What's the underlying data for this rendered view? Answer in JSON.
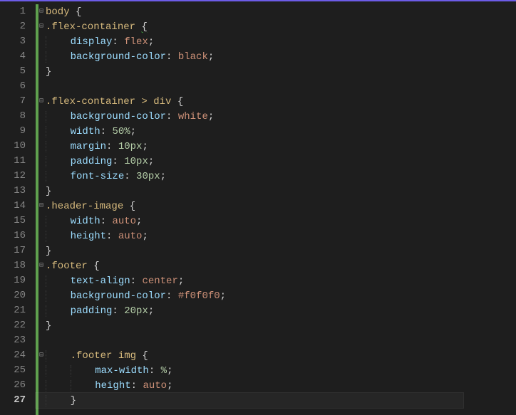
{
  "editor": {
    "activeLine": 27,
    "lines": [
      {
        "num": 1,
        "fold": "⊟",
        "indent": 0,
        "tokens": [
          [
            "sel",
            "body"
          ],
          [
            "punc",
            " {"
          ]
        ]
      },
      {
        "num": 2,
        "fold": "⊟",
        "indent": 0,
        "tokens": [
          [
            "sel",
            ".flex-container"
          ],
          [
            "punc",
            " "
          ],
          [
            "squiggle",
            "{"
          ]
        ]
      },
      {
        "num": 3,
        "fold": "",
        "indent": 1,
        "tokens": [
          [
            "prop",
            "display"
          ],
          [
            "punc",
            ": "
          ],
          [
            "val",
            "flex"
          ],
          [
            "punc",
            ";"
          ]
        ]
      },
      {
        "num": 4,
        "fold": "",
        "indent": 1,
        "tokens": [
          [
            "prop",
            "background-color"
          ],
          [
            "punc",
            ": "
          ],
          [
            "val",
            "black"
          ],
          [
            "punc",
            ";"
          ]
        ]
      },
      {
        "num": 5,
        "fold": "",
        "indent": 0,
        "tokens": [
          [
            "punc",
            "}"
          ]
        ]
      },
      {
        "num": 6,
        "fold": "",
        "indent": 0,
        "tokens": []
      },
      {
        "num": 7,
        "fold": "⊟",
        "indent": 0,
        "tokens": [
          [
            "sel",
            ".flex-container > div"
          ],
          [
            "punc",
            " {"
          ]
        ]
      },
      {
        "num": 8,
        "fold": "",
        "indent": 1,
        "tokens": [
          [
            "prop",
            "background-color"
          ],
          [
            "punc",
            ": "
          ],
          [
            "val",
            "white"
          ],
          [
            "punc",
            ";"
          ]
        ]
      },
      {
        "num": 9,
        "fold": "",
        "indent": 1,
        "tokens": [
          [
            "prop",
            "width"
          ],
          [
            "punc",
            ": "
          ],
          [
            "num",
            "50%"
          ],
          [
            "punc",
            ";"
          ]
        ]
      },
      {
        "num": 10,
        "fold": "",
        "indent": 1,
        "tokens": [
          [
            "prop",
            "margin"
          ],
          [
            "punc",
            ": "
          ],
          [
            "num",
            "10px"
          ],
          [
            "punc",
            ";"
          ]
        ]
      },
      {
        "num": 11,
        "fold": "",
        "indent": 1,
        "tokens": [
          [
            "prop",
            "padding"
          ],
          [
            "punc",
            ": "
          ],
          [
            "num",
            "10px"
          ],
          [
            "punc",
            ";"
          ]
        ]
      },
      {
        "num": 12,
        "fold": "",
        "indent": 1,
        "tokens": [
          [
            "prop",
            "font-size"
          ],
          [
            "punc",
            ": "
          ],
          [
            "num",
            "30px"
          ],
          [
            "punc",
            ";"
          ]
        ]
      },
      {
        "num": 13,
        "fold": "",
        "indent": 0,
        "tokens": [
          [
            "punc",
            "}"
          ]
        ]
      },
      {
        "num": 14,
        "fold": "⊟",
        "indent": 0,
        "tokens": [
          [
            "sel",
            ".header-image"
          ],
          [
            "punc",
            " {"
          ]
        ]
      },
      {
        "num": 15,
        "fold": "",
        "indent": 1,
        "tokens": [
          [
            "prop",
            "width"
          ],
          [
            "punc",
            ": "
          ],
          [
            "val",
            "auto"
          ],
          [
            "punc",
            ";"
          ]
        ]
      },
      {
        "num": 16,
        "fold": "",
        "indent": 1,
        "tokens": [
          [
            "prop",
            "height"
          ],
          [
            "punc",
            ": "
          ],
          [
            "val",
            "auto"
          ],
          [
            "punc",
            ";"
          ]
        ]
      },
      {
        "num": 17,
        "fold": "",
        "indent": 0,
        "tokens": [
          [
            "punc",
            "}"
          ]
        ]
      },
      {
        "num": 18,
        "fold": "⊟",
        "indent": 0,
        "tokens": [
          [
            "sel",
            ".footer"
          ],
          [
            "punc",
            " {"
          ]
        ]
      },
      {
        "num": 19,
        "fold": "",
        "indent": 1,
        "tokens": [
          [
            "prop",
            "text-align"
          ],
          [
            "punc",
            ": "
          ],
          [
            "val",
            "center"
          ],
          [
            "punc",
            ";"
          ]
        ]
      },
      {
        "num": 20,
        "fold": "",
        "indent": 1,
        "tokens": [
          [
            "prop",
            "background-color"
          ],
          [
            "punc",
            ": "
          ],
          [
            "val",
            "#f0f0f0"
          ],
          [
            "punc",
            ";"
          ]
        ]
      },
      {
        "num": 21,
        "fold": "",
        "indent": 1,
        "tokens": [
          [
            "prop",
            "padding"
          ],
          [
            "punc",
            ": "
          ],
          [
            "num",
            "20px"
          ],
          [
            "punc",
            ";"
          ]
        ]
      },
      {
        "num": 22,
        "fold": "",
        "indent": 0,
        "tokens": [
          [
            "punc",
            "}"
          ]
        ]
      },
      {
        "num": 23,
        "fold": "",
        "indent": 0,
        "tokens": []
      },
      {
        "num": 24,
        "fold": "⊟",
        "indent": 1,
        "tokens": [
          [
            "sel",
            ".footer img"
          ],
          [
            "punc",
            " {"
          ]
        ]
      },
      {
        "num": 25,
        "fold": "",
        "indent": 2,
        "tokens": [
          [
            "prop",
            "max-width"
          ],
          [
            "punc",
            ": "
          ],
          [
            "num",
            "%"
          ],
          [
            "punc",
            ";"
          ]
        ]
      },
      {
        "num": 26,
        "fold": "",
        "indent": 2,
        "tokens": [
          [
            "prop",
            "height"
          ],
          [
            "punc",
            ": "
          ],
          [
            "val",
            "auto"
          ],
          [
            "punc",
            ";"
          ]
        ]
      },
      {
        "num": 27,
        "fold": "",
        "indent": 1,
        "tokens": [
          [
            "punc",
            "}"
          ]
        ],
        "active": true
      }
    ]
  }
}
